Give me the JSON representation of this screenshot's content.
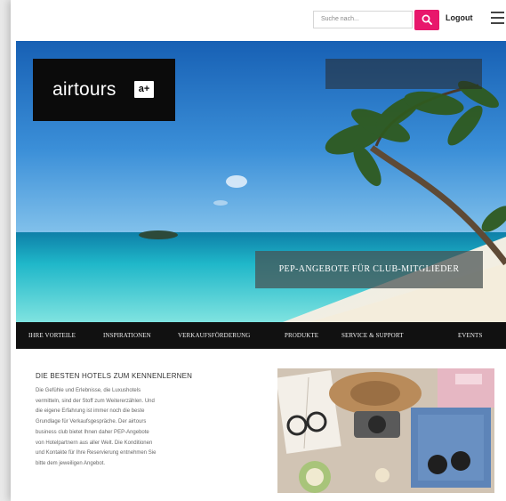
{
  "header": {
    "search_placeholder": "Suche nach...",
    "logout_label": "Logout"
  },
  "hero": {
    "logo_text": "airtours",
    "logo_mark": "a+",
    "credit_text": "",
    "pep_banner": "PEP-ANGEBOTE FÜR CLUB-MITGLIEDER"
  },
  "nav": {
    "items": [
      {
        "label": "IHRE VORTEILE"
      },
      {
        "label": "INSPIRATIONEN"
      },
      {
        "label": "VERKAUFSFÖRDERUNG"
      },
      {
        "label": "PRODUKTE"
      },
      {
        "label": "SERVICE & SUPPORT"
      },
      {
        "label": "EVENTS"
      }
    ]
  },
  "content": {
    "title": "DIE BESTEN HOTELS ZUM KENNENLERNEN",
    "body_lines": [
      "Die Gefühle und Erlebnisse, die Luxushotels",
      "vermitteln, sind der Stoff zum Weitererzählen. Und",
      "die eigene Erfahrung ist immer noch die beste",
      "Grundlage für Verkaufsgespräche. Der airtours",
      "business club bietet Ihnen daher PEP-Angebote",
      "von Hotelpartnern aus aller Welt. Die Konditionen",
      "und Kontakte für Ihre Reservierung entnehmen Sie",
      "bitte dem jeweiligen Angebot."
    ]
  },
  "colors": {
    "accent": "#e8176c",
    "nav_bg": "#111111",
    "logo_bg": "#0b0b0b"
  }
}
